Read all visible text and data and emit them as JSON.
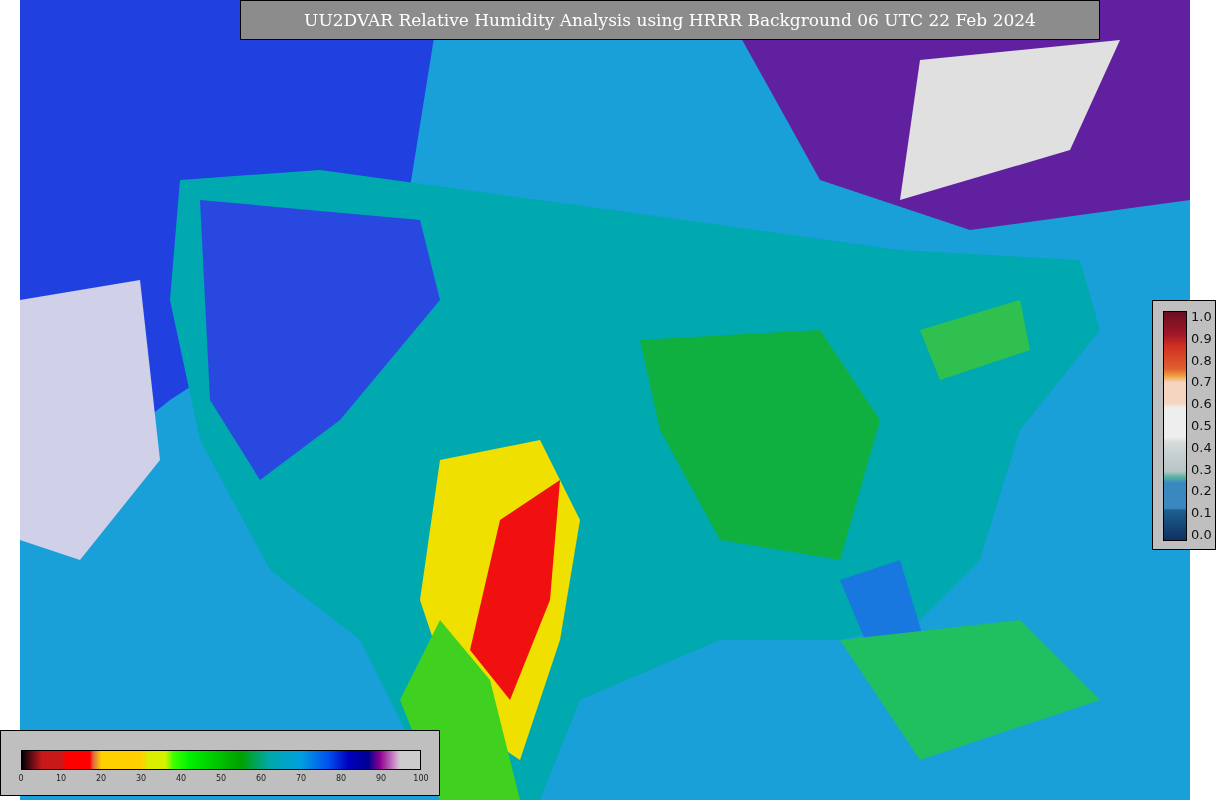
{
  "title": "UU2DVAR Relative Humidity Analysis using HRRR Background 06 UTC 22 Feb 2024",
  "humidity_colorbar": {
    "ticks": [
      "0",
      "10",
      "20",
      "30",
      "40",
      "50",
      "60",
      "70",
      "80",
      "90",
      "100"
    ]
  },
  "ratio_colorbar": {
    "ticks": [
      "1.0",
      "0.9",
      "0.8",
      "0.7",
      "0.6",
      "0.5",
      "0.4",
      "0.3",
      "0.2",
      "0.1",
      "0.0"
    ]
  }
}
